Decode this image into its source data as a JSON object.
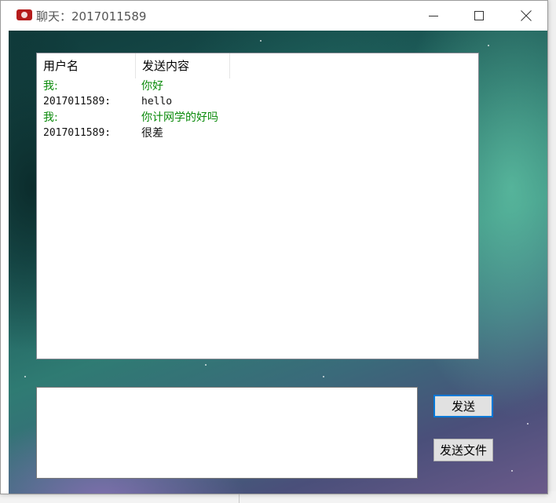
{
  "window": {
    "title": "聊天：2017011589",
    "icon": "app-logo-icon"
  },
  "chat": {
    "columns": [
      "用户名",
      "发送内容"
    ],
    "messages": [
      {
        "user": "我:",
        "content": "你好",
        "is_self": true
      },
      {
        "user": "2017011589:",
        "content": "hello",
        "is_self": false
      },
      {
        "user": "我:",
        "content": "你计网学的好吗",
        "is_self": true
      },
      {
        "user": "2017011589:",
        "content": "很差",
        "is_self": false
      }
    ]
  },
  "input": {
    "value": "",
    "placeholder": ""
  },
  "buttons": {
    "send": "发送",
    "send_file": "发送文件"
  },
  "colors": {
    "self_message": "#0a8a0a",
    "other_message": "#111111",
    "send_button_focus": "#0078d7"
  }
}
